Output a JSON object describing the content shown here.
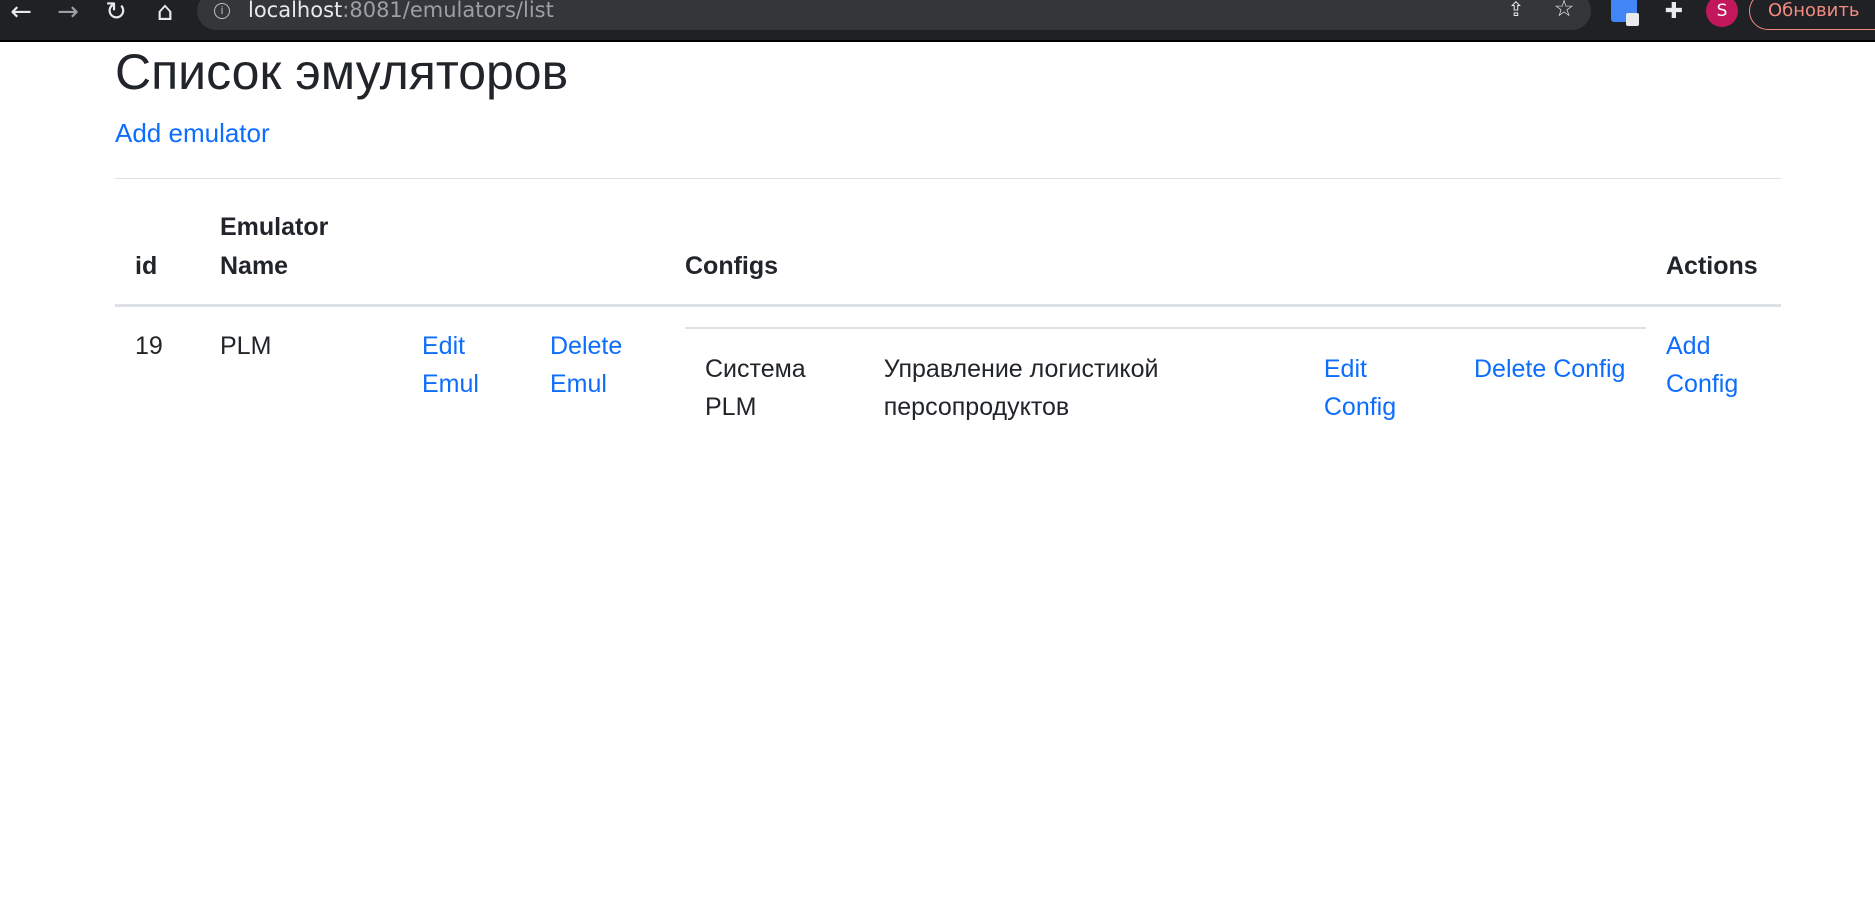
{
  "browser": {
    "url_host": "localhost",
    "url_rest": ":8081/emulators/list",
    "avatar_letter": "S",
    "update_label": "Обновить"
  },
  "page": {
    "title": "Список эмуляторов",
    "add_emulator": "Add emulator"
  },
  "table": {
    "headers": {
      "id": "id",
      "name": "Emulator Name",
      "configs": "Configs",
      "actions": "Actions"
    },
    "rows": [
      {
        "id": "19",
        "name": "PLM",
        "edit_label": "Edit Emul",
        "delete_label": "Delete Emul",
        "configs": [
          {
            "name": "Система PLM",
            "description": "Управление логистикой персопродуктов",
            "edit_label": "Edit Config",
            "delete_label": "Delete Config"
          }
        ],
        "add_config_label": "Add Config"
      }
    ]
  }
}
